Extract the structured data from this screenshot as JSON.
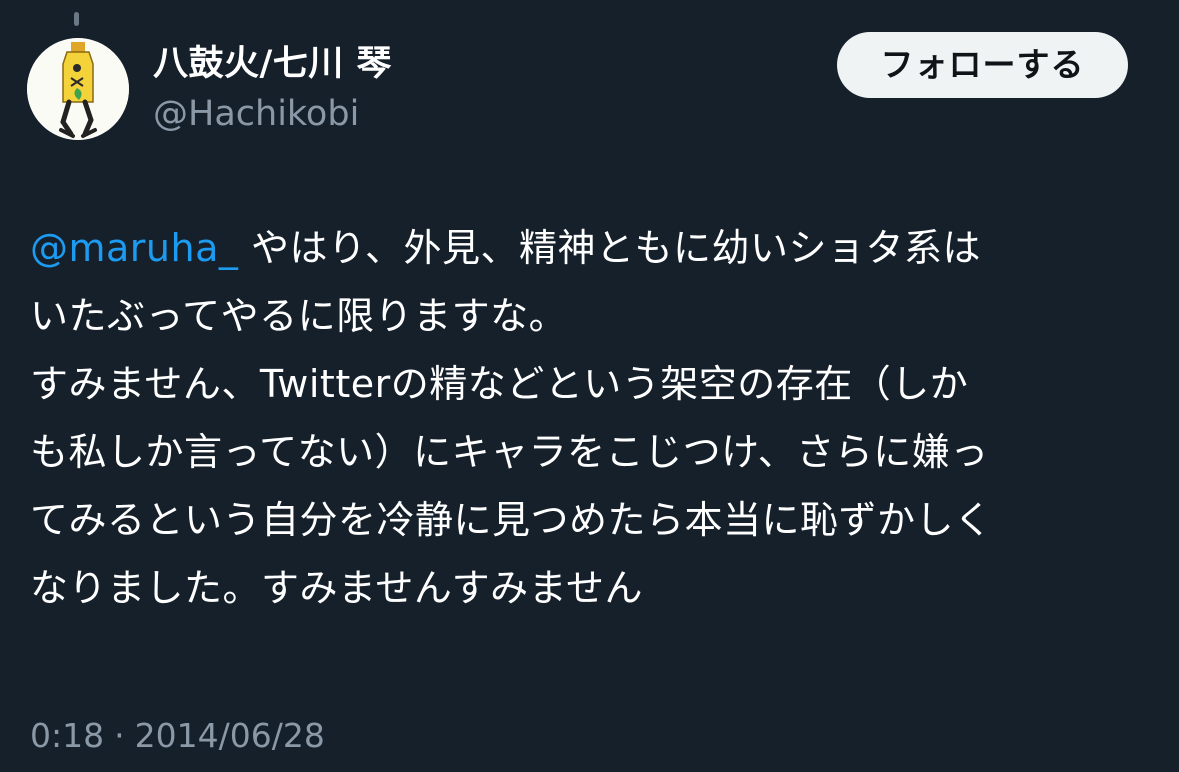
{
  "author": {
    "display_name": "八鼓火/七川 琴",
    "handle": "@Hachikobi"
  },
  "follow_button_label": "フォローする",
  "tweet": {
    "mention": "@maruha_",
    "lines": {
      "l1": "やはり、外見、精神ともに幼いショタ系は",
      "l2": "いたぶってやるに限りますな。",
      "l3": "すみません、Twitterの精などという架空の存在（しか",
      "l4": "も私しか言ってない）にキャラをこじつけ、さらに嫌っ",
      "l5": "てみるという自分を冷静に見つめたら本当に恥ずかしく",
      "l6": "なりました。すみませんすみません"
    }
  },
  "meta": {
    "time": "0:18",
    "separator": "·",
    "date": "2014/06/28"
  },
  "colors": {
    "background": "#15202b",
    "text": "#ffffff",
    "secondary_text": "#8b98a5",
    "link": "#1d9bf0",
    "button_bg": "#eff3f4",
    "button_text": "#0f1419"
  }
}
